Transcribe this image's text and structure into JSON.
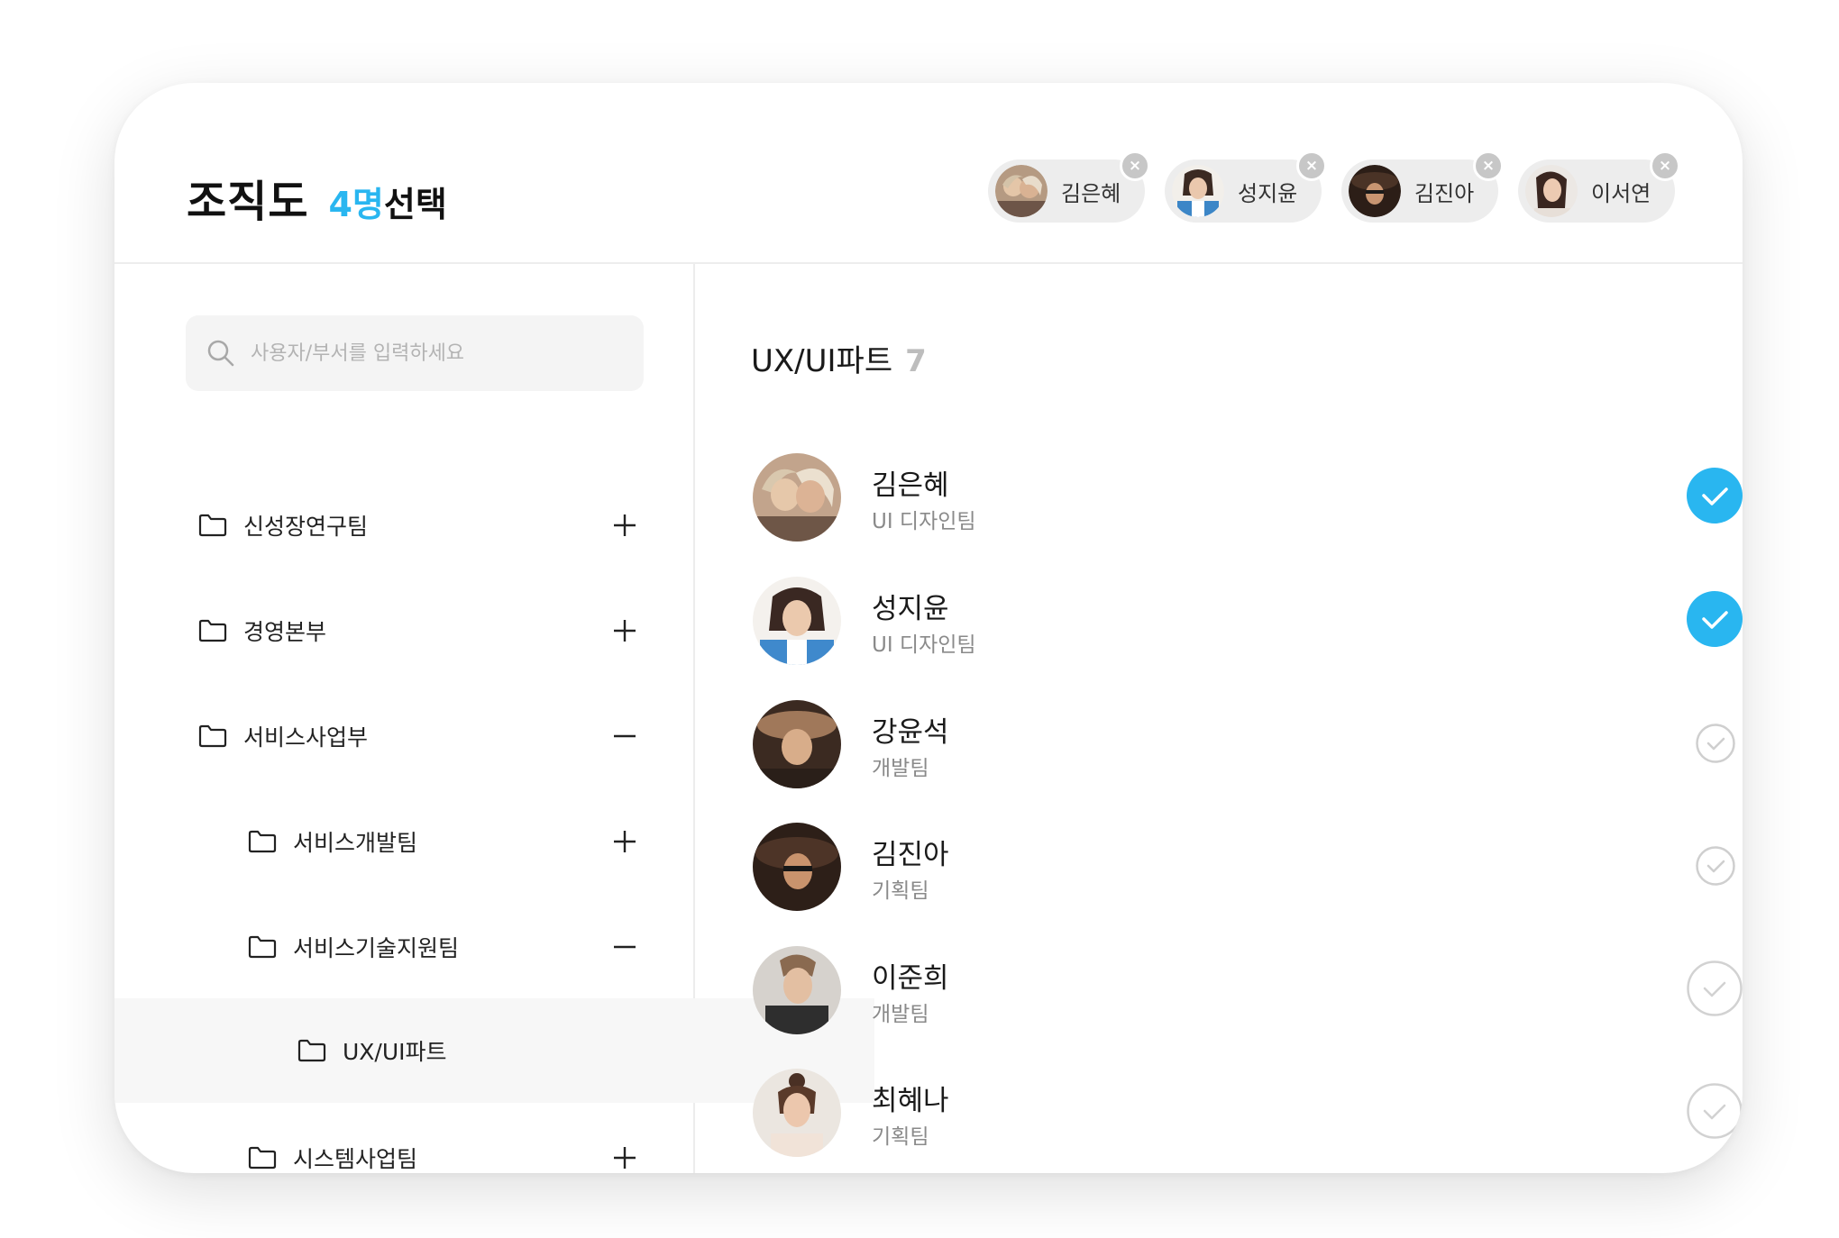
{
  "header": {
    "title": "조직도",
    "selected_count": "4명",
    "selected_suffix": "선택",
    "chips": [
      {
        "name": "김은혜"
      },
      {
        "name": "성지윤"
      },
      {
        "name": "김진아"
      },
      {
        "name": "이서연"
      }
    ],
    "chip_close_glyph": "×"
  },
  "sidebar": {
    "search_placeholder": "사용자/부서를 입력하세요",
    "items": [
      {
        "label": "신성장연구팀",
        "toggle": "plus"
      },
      {
        "label": "경영본부",
        "toggle": "plus"
      },
      {
        "label": "서비스사업부",
        "toggle": "minus"
      },
      {
        "label": "서비스개발팀",
        "toggle": "plus"
      },
      {
        "label": "서비스기술지원팀",
        "toggle": "minus"
      },
      {
        "label": "UX/UI파트",
        "toggle": "none",
        "selected": true
      },
      {
        "label": "시스템사업팀",
        "toggle": "plus"
      }
    ]
  },
  "main": {
    "part_title": "UX/UI파트",
    "part_count": "7",
    "members": [
      {
        "name": "김은혜",
        "team": "UI 디자인팀",
        "checked": true
      },
      {
        "name": "성지윤",
        "team": "UI 디자인팀",
        "checked": true
      },
      {
        "name": "강윤석",
        "team": "개발팀",
        "checked": false
      },
      {
        "name": "김진아",
        "team": "기획팀",
        "checked": false
      },
      {
        "name": "이준희",
        "team": "개발팀",
        "checked": false
      },
      {
        "name": "최혜나",
        "team": "기획팀",
        "checked": false
      }
    ]
  },
  "colors": {
    "accent": "#29b6f0",
    "chip_bg": "#ededed",
    "muted_text": "#8a8a8a"
  }
}
